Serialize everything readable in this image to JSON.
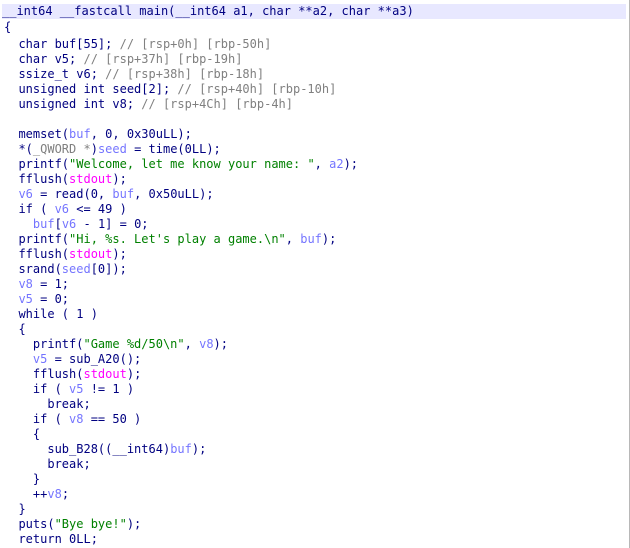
{
  "pseudocode": {
    "lines": [
      [
        [
          "type",
          "__int64 __fastcall main(__int64 a1, char **a2, char **a3)"
        ]
      ],
      [
        [
          "kw",
          "{"
        ]
      ],
      [
        [
          "kw",
          "  char buf[55]; "
        ],
        [
          "cmt",
          "// [rsp+0h] [rbp-50h]"
        ]
      ],
      [
        [
          "kw",
          "  char v5; "
        ],
        [
          "cmt",
          "// [rsp+37h] [rbp-19h]"
        ]
      ],
      [
        [
          "kw",
          "  ssize_t v6; "
        ],
        [
          "cmt",
          "// [rsp+38h] [rbp-18h]"
        ]
      ],
      [
        [
          "kw",
          "  unsigned int seed[2]; "
        ],
        [
          "cmt",
          "// [rsp+40h] [rbp-10h]"
        ]
      ],
      [
        [
          "kw",
          "  unsigned int v8; "
        ],
        [
          "cmt",
          "// [rsp+4Ch] [rbp-4h]"
        ]
      ],
      [
        [
          "kw",
          ""
        ]
      ],
      [
        [
          "kw",
          "  memset("
        ],
        [
          "var",
          "buf"
        ],
        [
          "kw",
          ", 0, 0x30uLL);"
        ]
      ],
      [
        [
          "kw",
          "  *("
        ],
        [
          "cmt",
          "_QWORD *"
        ],
        [
          "kw",
          ")"
        ],
        [
          "var",
          "seed"
        ],
        [
          "kw",
          " = time(0LL);"
        ]
      ],
      [
        [
          "kw",
          "  printf("
        ],
        [
          "str",
          "\"Welcome, let me know your name: \""
        ],
        [
          "kw",
          ", "
        ],
        [
          "var",
          "a2"
        ],
        [
          "kw",
          ");"
        ]
      ],
      [
        [
          "kw",
          "  fflush("
        ],
        [
          "glob",
          "stdout"
        ],
        [
          "kw",
          ");"
        ]
      ],
      [
        [
          "var",
          "  v6"
        ],
        [
          "kw",
          " = read(0, "
        ],
        [
          "var",
          "buf"
        ],
        [
          "kw",
          ", 0x50uLL);"
        ]
      ],
      [
        [
          "kw",
          "  if ( "
        ],
        [
          "var",
          "v6"
        ],
        [
          "kw",
          " <= 49 )"
        ]
      ],
      [
        [
          "var",
          "    buf"
        ],
        [
          "kw",
          "["
        ],
        [
          "var",
          "v6"
        ],
        [
          "kw",
          " - 1] = 0;"
        ]
      ],
      [
        [
          "kw",
          "  printf("
        ],
        [
          "str",
          "\"Hi, %s. Let's play a game.\\n\""
        ],
        [
          "kw",
          ", "
        ],
        [
          "var",
          "buf"
        ],
        [
          "kw",
          ");"
        ]
      ],
      [
        [
          "kw",
          "  fflush("
        ],
        [
          "glob",
          "stdout"
        ],
        [
          "kw",
          ");"
        ]
      ],
      [
        [
          "kw",
          "  srand("
        ],
        [
          "var",
          "seed"
        ],
        [
          "kw",
          "[0]);"
        ]
      ],
      [
        [
          "var",
          "  v8"
        ],
        [
          "kw",
          " = 1;"
        ]
      ],
      [
        [
          "var",
          "  v5"
        ],
        [
          "kw",
          " = 0;"
        ]
      ],
      [
        [
          "kw",
          "  while ( 1 )"
        ]
      ],
      [
        [
          "kw",
          "  {"
        ]
      ],
      [
        [
          "kw",
          "    printf("
        ],
        [
          "str",
          "\"Game %d/50\\n\""
        ],
        [
          "kw",
          ", "
        ],
        [
          "var",
          "v8"
        ],
        [
          "kw",
          ");"
        ]
      ],
      [
        [
          "var",
          "    v5"
        ],
        [
          "kw",
          " = sub_A20();"
        ]
      ],
      [
        [
          "kw",
          "    fflush("
        ],
        [
          "glob",
          "stdout"
        ],
        [
          "kw",
          ");"
        ]
      ],
      [
        [
          "kw",
          "    if ( "
        ],
        [
          "var",
          "v5"
        ],
        [
          "kw",
          " != 1 )"
        ]
      ],
      [
        [
          "kw",
          "      break;"
        ]
      ],
      [
        [
          "kw",
          "    if ( "
        ],
        [
          "var",
          "v8"
        ],
        [
          "kw",
          " == 50 )"
        ]
      ],
      [
        [
          "kw",
          "    {"
        ]
      ],
      [
        [
          "kw",
          "      sub_B28(("
        ],
        [
          "type",
          "__int64"
        ],
        [
          "kw",
          ")"
        ],
        [
          "var",
          "buf"
        ],
        [
          "kw",
          ");"
        ]
      ],
      [
        [
          "kw",
          "      break;"
        ]
      ],
      [
        [
          "kw",
          "    }"
        ]
      ],
      [
        [
          "kw",
          "    ++"
        ],
        [
          "var",
          "v8"
        ],
        [
          "kw",
          ";"
        ]
      ],
      [
        [
          "kw",
          "  }"
        ]
      ],
      [
        [
          "kw",
          "  puts("
        ],
        [
          "str",
          "\"Bye bye!\""
        ],
        [
          "kw",
          ");"
        ]
      ],
      [
        [
          "kw",
          "  return 0LL;"
        ]
      ]
    ]
  }
}
